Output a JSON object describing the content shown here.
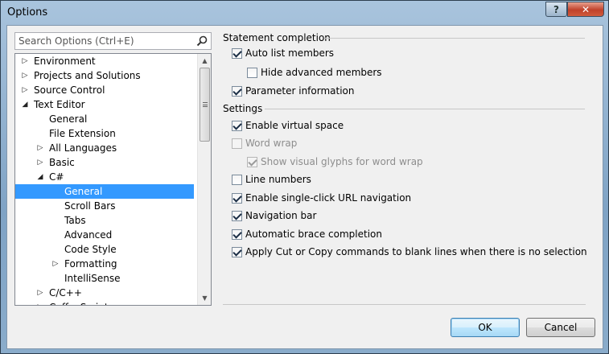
{
  "window": {
    "title": "Options",
    "help_label": "?",
    "close_label": "✕"
  },
  "search": {
    "placeholder": "Search Options (Ctrl+E)"
  },
  "tree": {
    "items": [
      {
        "label": "Environment",
        "level": 0,
        "toggle": "▷"
      },
      {
        "label": "Projects and Solutions",
        "level": 0,
        "toggle": "▷"
      },
      {
        "label": "Source Control",
        "level": 0,
        "toggle": "▷"
      },
      {
        "label": "Text Editor",
        "level": 0,
        "toggle": "◢"
      },
      {
        "label": "General",
        "level": 1,
        "toggle": ""
      },
      {
        "label": "File Extension",
        "level": 1,
        "toggle": ""
      },
      {
        "label": "All Languages",
        "level": 1,
        "toggle": "▷"
      },
      {
        "label": "Basic",
        "level": 1,
        "toggle": "▷"
      },
      {
        "label": "C#",
        "level": 1,
        "toggle": "◢"
      },
      {
        "label": "General",
        "level": 2,
        "toggle": "",
        "selected": true
      },
      {
        "label": "Scroll Bars",
        "level": 2,
        "toggle": ""
      },
      {
        "label": "Tabs",
        "level": 2,
        "toggle": ""
      },
      {
        "label": "Advanced",
        "level": 2,
        "toggle": ""
      },
      {
        "label": "Code Style",
        "level": 2,
        "toggle": ""
      },
      {
        "label": "Formatting",
        "level": 2,
        "toggle": "▷"
      },
      {
        "label": "IntelliSense",
        "level": 2,
        "toggle": ""
      },
      {
        "label": "C/C++",
        "level": 1,
        "toggle": "▷"
      },
      {
        "label": "CoffeeScript",
        "level": 1,
        "toggle": "▷"
      }
    ]
  },
  "statement_completion": {
    "header": "Statement completion",
    "auto_list_members": {
      "label": "Auto list members",
      "checked": true
    },
    "hide_advanced_members": {
      "label": "Hide advanced members",
      "checked": false
    },
    "parameter_information": {
      "label": "Parameter information",
      "checked": true
    }
  },
  "settings": {
    "header": "Settings",
    "enable_virtual_space": {
      "label": "Enable virtual space",
      "checked": true
    },
    "word_wrap": {
      "label": "Word wrap",
      "checked": false,
      "disabled": true
    },
    "show_visual_glyphs": {
      "label": "Show visual glyphs for word wrap",
      "checked": true,
      "disabled": true
    },
    "line_numbers": {
      "label": "Line numbers",
      "checked": false
    },
    "single_click_url": {
      "label": "Enable single-click URL navigation",
      "checked": true
    },
    "navigation_bar": {
      "label": "Navigation bar",
      "checked": true
    },
    "brace_completion": {
      "label": "Automatic brace completion",
      "checked": true
    },
    "cut_copy_blank_lines": {
      "label": "Apply Cut or Copy commands to blank lines when there is no selection",
      "checked": true
    }
  },
  "buttons": {
    "ok_label": "OK",
    "cancel_label": "Cancel"
  }
}
